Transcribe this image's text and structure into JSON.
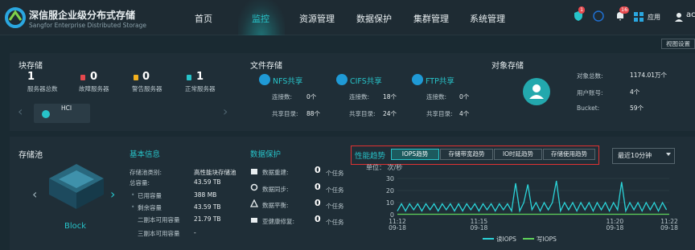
{
  "brand": {
    "name_cn": "深信服企业级分布式存储",
    "name_en": "Sangfor Enterprise Distributed Storage"
  },
  "nav": [
    "首页",
    "监控",
    "资源管理",
    "数据保护",
    "集群管理",
    "系统管理"
  ],
  "nav_active": "监控",
  "topbar": {
    "shield_badge": "1",
    "bell_badge": "16",
    "apps_label": "应用",
    "user": "ac"
  },
  "view_settings": "视图设置",
  "block": {
    "title": "块存储",
    "total": "1",
    "total_label": "服务器总数",
    "faulty": "0",
    "faulty_label": "故障服务器",
    "warning": "0",
    "warning_label": "警告服务器",
    "normal": "1",
    "normal_label": "正常服务器",
    "hci_label": "HCI"
  },
  "file": {
    "title": "文件存储",
    "shares": [
      {
        "name": "NFS共享",
        "conn_label": "连接数:",
        "conn": "0个",
        "dir_label": "共享目录:",
        "dir": "88个"
      },
      {
        "name": "CIFS共享",
        "conn_label": "连接数:",
        "conn": "18个",
        "dir_label": "共享目录:",
        "dir": "24个"
      },
      {
        "name": "FTP共享",
        "conn_label": "连接数:",
        "conn": "0个",
        "dir_label": "共享目录:",
        "dir": "4个"
      }
    ]
  },
  "object": {
    "title": "对象存储",
    "rows": [
      {
        "label": "对象总数:",
        "value": "1174.01万个"
      },
      {
        "label": "用户账号:",
        "value": "4个"
      },
      {
        "label": "Bucket:",
        "value": "59个"
      }
    ]
  },
  "pool": {
    "title": "存储池",
    "name": "Block"
  },
  "basic": {
    "title": "基本信息",
    "rows": [
      {
        "label": "存储池类别:",
        "value": "高性能块存储池"
      },
      {
        "label": "总容量:",
        "value": "43.59 TB"
      },
      {
        "label": "已用容量",
        "value": "388 MB"
      },
      {
        "label": "剩余容量",
        "value": "43.59 TB"
      },
      {
        "label": "二副本可用容量",
        "value": "21.79 TB"
      },
      {
        "label": "三副本可用容量",
        "value": "-"
      }
    ]
  },
  "protection": {
    "title": "数据保护",
    "rows": [
      {
        "label": "数据重建:",
        "value": "0",
        "unit": "个任务"
      },
      {
        "label": "数据同步:",
        "value": "0",
        "unit": "个任务"
      },
      {
        "label": "数据平衡:",
        "value": "0",
        "unit": "个任务"
      },
      {
        "label": "亚健康修复:",
        "value": "0",
        "unit": "个任务"
      }
    ]
  },
  "trend": {
    "title": "性能趋势",
    "tabs": [
      "IOPS趋势",
      "存储带宽趋势",
      "IO时延趋势",
      "存储使用趋势"
    ],
    "active_tab": "IOPS趋势",
    "range": "最近10分钟"
  },
  "colors": {
    "accent": "#27c3c9",
    "read": "#2bd3d8",
    "write": "#5fd35a"
  },
  "chart_data": {
    "type": "line",
    "unit_label": "单位： 次/秒",
    "yticks": [
      "0",
      "10",
      "20",
      "30"
    ],
    "ylim": [
      0,
      30
    ],
    "xlim": [
      0,
      10
    ],
    "xticks": [
      {
        "x": 0,
        "time": "11:12",
        "date": "09-18"
      },
      {
        "x": 3,
        "time": "11:15",
        "date": "09-18"
      },
      {
        "x": 8,
        "time": "11:20",
        "date": "09-18"
      },
      {
        "x": 10,
        "time": "11:22",
        "date": "09-18"
      }
    ],
    "legend": [
      "读IOPS",
      "写IOPS"
    ],
    "series": [
      {
        "name": "读IOPS",
        "x": [
          0,
          0.15,
          0.3,
          0.45,
          0.6,
          0.75,
          0.9,
          1.05,
          1.2,
          1.35,
          1.5,
          1.65,
          1.8,
          1.95,
          2.1,
          2.25,
          2.4,
          2.55,
          2.7,
          2.85,
          3.0,
          3.15,
          3.3,
          3.45,
          3.6,
          3.75,
          3.9,
          4.05,
          4.2,
          4.35,
          4.5,
          4.65,
          4.8,
          4.95,
          5.1,
          5.25,
          5.4,
          5.55,
          5.7,
          5.85,
          6.0,
          6.15,
          6.3,
          6.45,
          6.6,
          6.75,
          6.9,
          7.05,
          7.2,
          7.35,
          7.5,
          7.65,
          7.8,
          7.95,
          8.1,
          8.25,
          8.4,
          8.55,
          8.7,
          8.85,
          9.0,
          9.15,
          9.3,
          9.45,
          9.6,
          9.75,
          9.9
        ],
        "values": [
          3,
          9,
          3,
          9,
          4,
          9,
          3,
          9,
          4,
          9,
          3,
          9,
          4,
          9,
          3,
          9,
          3,
          9,
          4,
          9,
          3,
          9,
          4,
          9,
          3,
          9,
          4,
          9,
          3,
          26,
          3,
          10,
          25,
          4,
          10,
          3,
          10,
          4,
          10,
          28,
          3,
          10,
          4,
          10,
          3,
          10,
          4,
          10,
          3,
          10,
          4,
          10,
          3,
          10,
          4,
          27,
          3,
          10,
          4,
          10,
          3,
          10,
          4,
          10,
          3,
          10,
          4
        ]
      },
      {
        "name": "写IOPS",
        "x": [
          0,
          2,
          4,
          6,
          8,
          10
        ],
        "values": [
          0.3,
          0.3,
          0.3,
          0.3,
          0.3,
          0.3
        ]
      }
    ]
  }
}
